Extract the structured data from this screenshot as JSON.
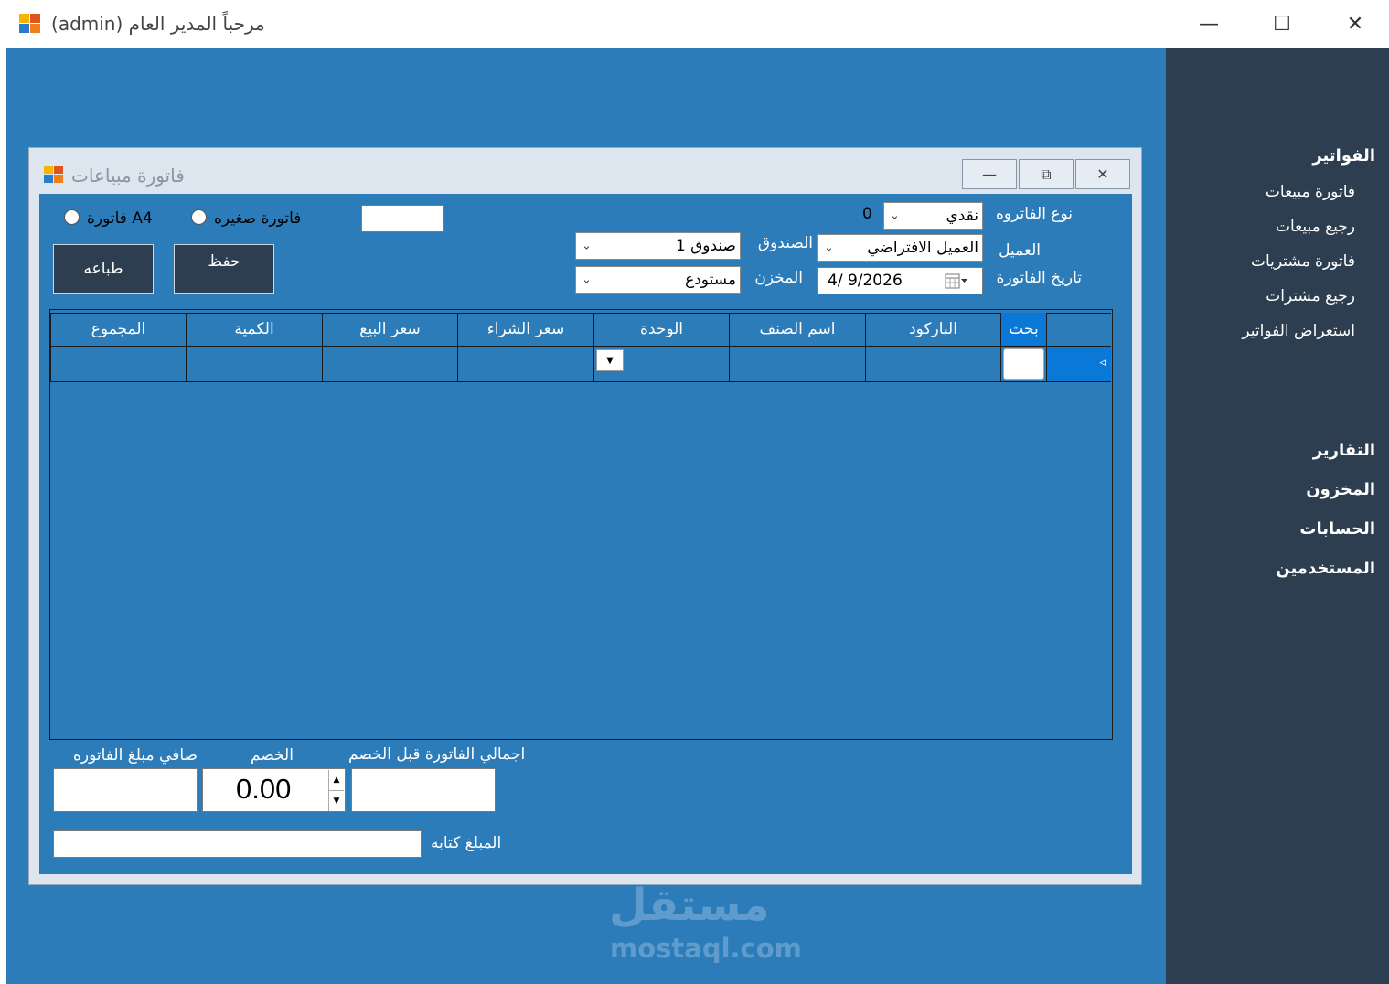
{
  "outer_window": {
    "title": "مرحباً المدير العام (admin)",
    "minimize_glyph": "—",
    "maximize_glyph": "☐",
    "close_glyph": "✕"
  },
  "sidebar": {
    "invoices_header": "الفواتير",
    "items": [
      "فاتورة مبيعات",
      "رجيع مبيعات",
      "فاتورة مشتريات",
      "رجيع مشترات",
      "استعراض الفواتير"
    ],
    "reports": "التقارير",
    "inventory": "المخزون",
    "accounts": "الحسابات",
    "users": "المستخدمين"
  },
  "child_window": {
    "title": "فاتورة مبياعات",
    "minimize_glyph": "—",
    "maximize_glyph": "⧉",
    "close_glyph": "✕"
  },
  "form": {
    "invoice_type_label": "نوع الفاتروه",
    "invoice_type_value": "نقدي",
    "invoice_number": "0",
    "customer_label": "العميل",
    "customer_value": "العميل الافتراضي",
    "date_label": "تاريخ الفاتورة",
    "date_value": "4/  9/2026",
    "cashbox_label": "الصندوق",
    "cashbox_value": "صندوق 1",
    "warehouse_label": "المخزن",
    "warehouse_value": "مستودع",
    "radio_small": "فاتورة صغيره",
    "radio_a4": "A4 فاتورة",
    "save_label": "حفظ",
    "print_label": "طباعه"
  },
  "grid": {
    "search_header": "بحث",
    "columns": [
      "الباركود",
      "اسم الصنف",
      "الوحدة",
      "سعر الشراء",
      "سعر البيع",
      "الكمية",
      "المجموع"
    ],
    "row_marker": "◃"
  },
  "totals": {
    "total_before_discount_label": "اجمالي الفاتورة قبل الخصم",
    "discount_label": "الخصم",
    "discount_value": "0.00",
    "net_label": "صافي مبلغ الفاتوره",
    "amount_in_words_label": "المبلغ كتابه"
  },
  "watermark": {
    "arabic": "مستقل",
    "latin": "mostaql.com"
  },
  "colors": {
    "client_blue": "#2c7cba",
    "sidebar_dark": "#2d3e50",
    "selection_blue": "#0a78d7"
  }
}
